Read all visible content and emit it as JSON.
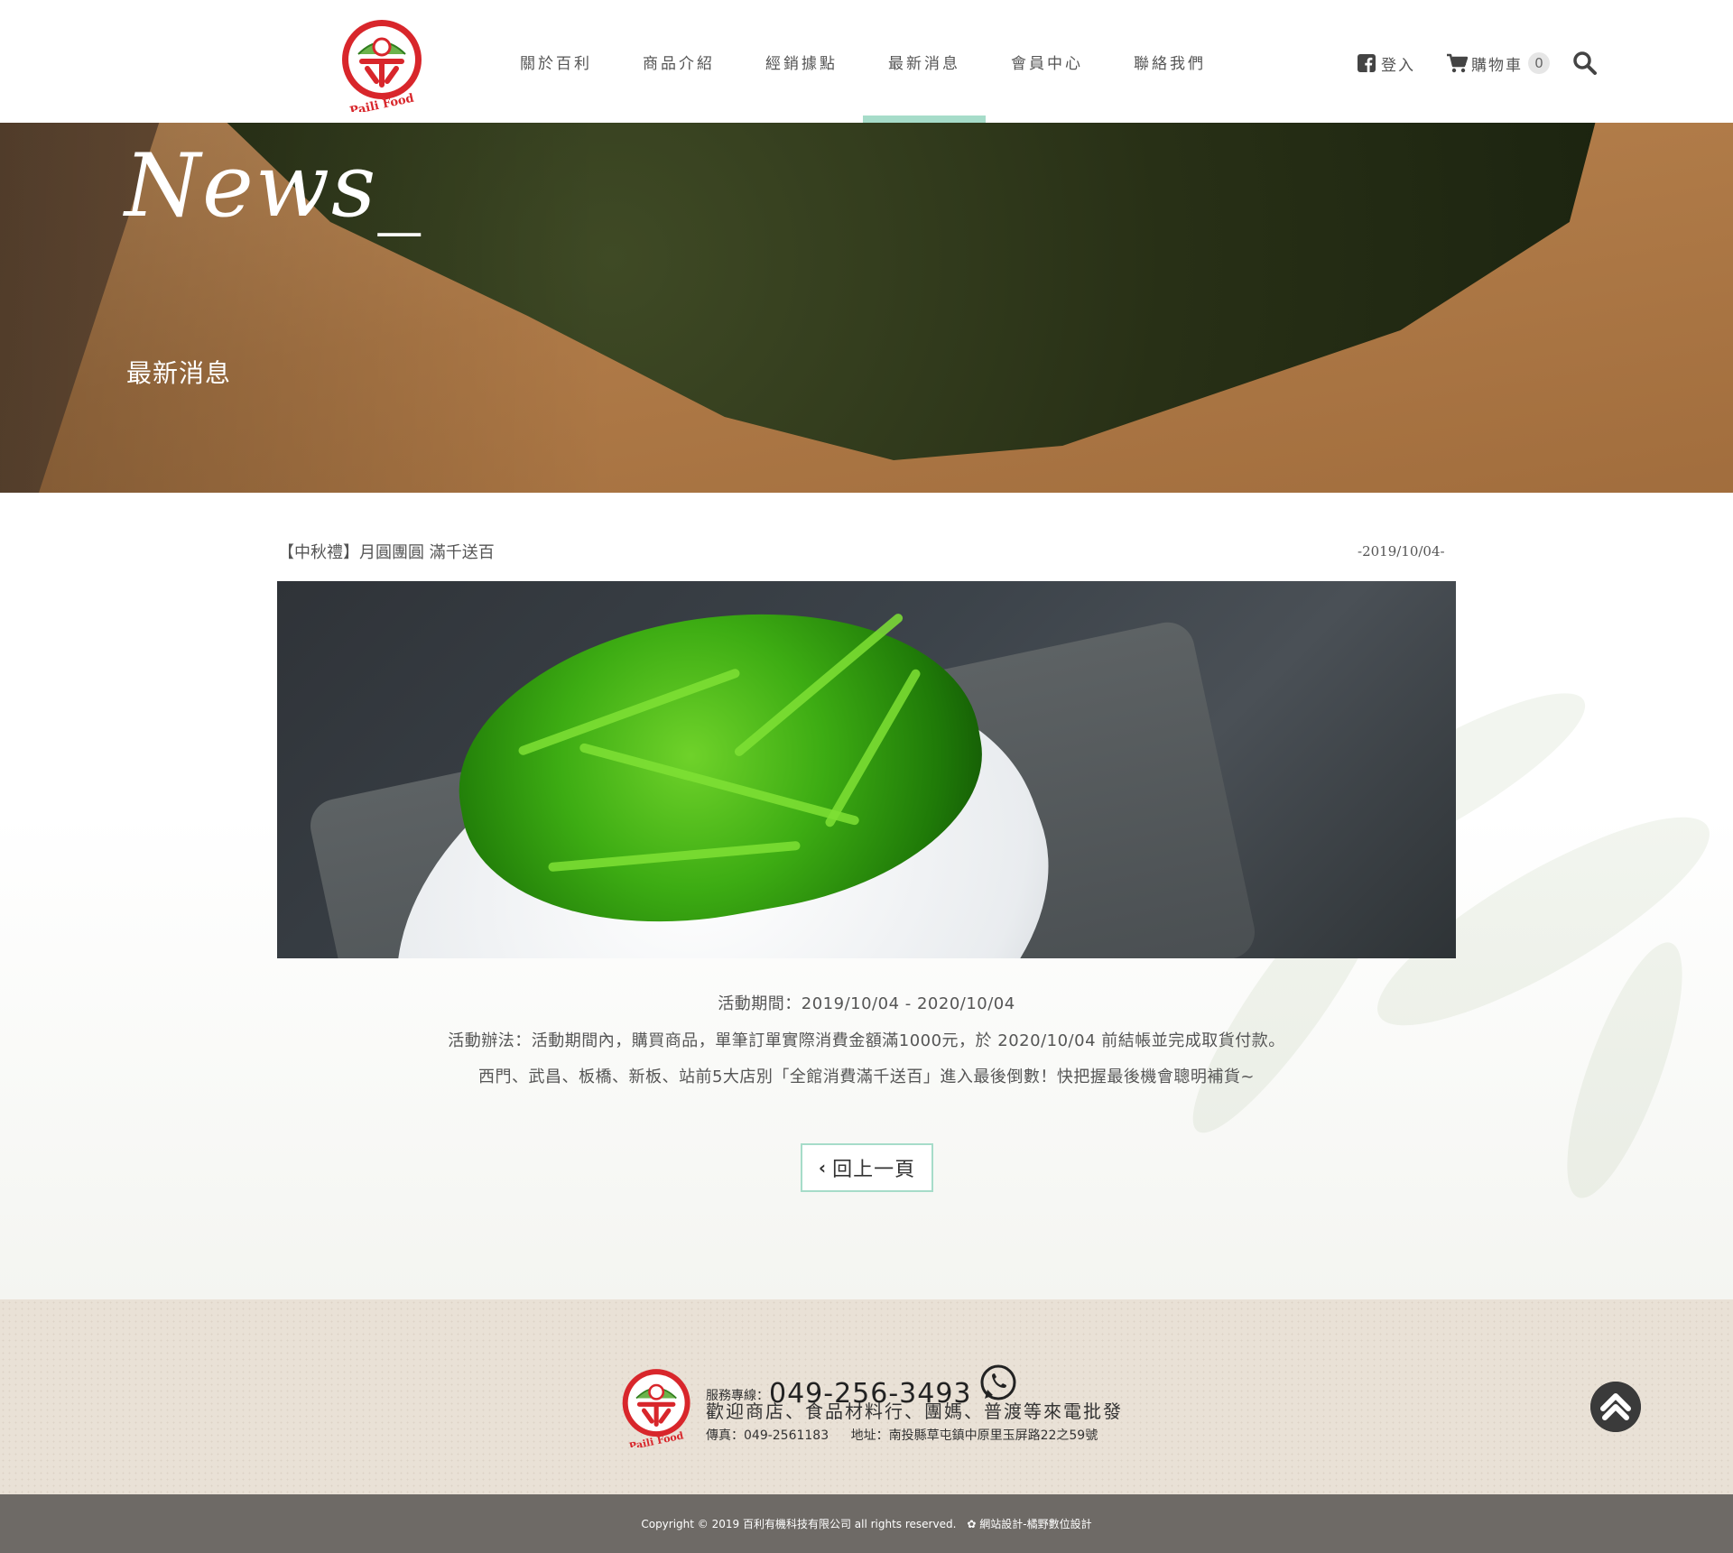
{
  "header": {
    "nav": [
      {
        "label": "關於百利"
      },
      {
        "label": "商品介紹"
      },
      {
        "label": "經銷據點"
      },
      {
        "label": "最新消息"
      },
      {
        "label": "會員中心"
      },
      {
        "label": "聯絡我們"
      }
    ],
    "active_nav": "最新消息",
    "login_label": "登入",
    "cart_label": "購物車",
    "cart_count": "0",
    "logo_text": "Paili Food"
  },
  "banner": {
    "title": "News_",
    "subtitle": "最新消息"
  },
  "article": {
    "title": "【中秋禮】月圓團圓 滿千送百",
    "date": "-2019/10/04-",
    "lines": [
      "活動期間：2019/10/04 - 2020/10/04",
      "活動辦法：活動期間內，購買商品，單筆訂單實際消費金額滿1000元，於 2020/10/04 前結帳並完成取貨付款。",
      "西門、武昌、板橋、新板、站前5大店別「全館消費滿千送百」進入最後倒數！快把握最後機會聰明補貨~"
    ],
    "back_label": "回上一頁"
  },
  "footer": {
    "service_label": "服務專線：",
    "phone": "049-256-3493",
    "slogan": "歡迎商店、食品材料行、團媽、普渡等來電批發",
    "fax": "傳真：049-2561183",
    "address": "地址：南投縣草屯鎮中原里玉屏路22之59號",
    "copyright": "Copyright © 2019 百利有機科技有限公司 all rights reserved.",
    "designer": "網站設計-橘野數位設計"
  },
  "colors": {
    "accent": "#a6dcc9",
    "logo_red": "#d8262b",
    "footer_bar": "#6e6a66"
  }
}
